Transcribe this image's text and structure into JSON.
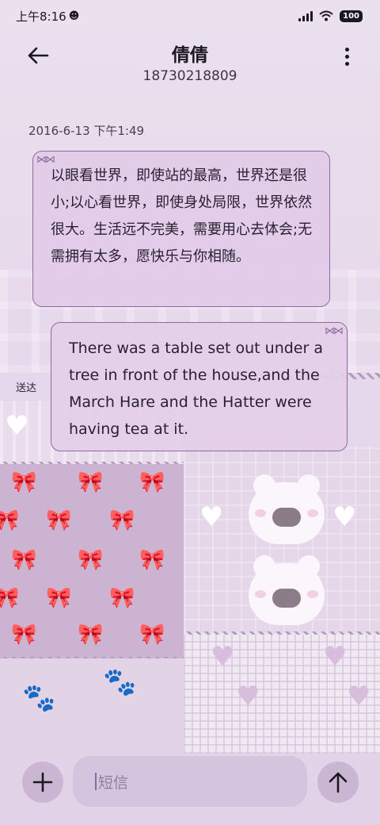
{
  "status_bar": {
    "time": "上午8:16",
    "battery": "100"
  },
  "header": {
    "contact_name": "倩倩",
    "contact_number": "18730218809",
    "back_icon": "arrow-left-icon",
    "more_icon": "more-vertical-icon"
  },
  "conversation": {
    "timestamp": "2016-6-13 下午1:49",
    "messages": [
      {
        "direction": "incoming",
        "text": "以眼看世界，即使站的最高，世界还是很小;以心看世界，即使身处局限，世界依然很大。生活远不完美，需要用心去体会;无需拥有太多，愿快乐与你相随。"
      },
      {
        "direction": "outgoing",
        "text": "There was a table set out under a tree in front of the house,and the March Hare and the Hatter were having tea at it.",
        "status": "送达"
      }
    ]
  },
  "composer": {
    "placeholder": "短信",
    "add_icon": "plus-icon",
    "send_icon": "arrow-up-icon"
  },
  "colors": {
    "bubble_border": "#8e6aa0",
    "bubble_fill": "#e1cbe8",
    "background": "#e6d8ea"
  }
}
